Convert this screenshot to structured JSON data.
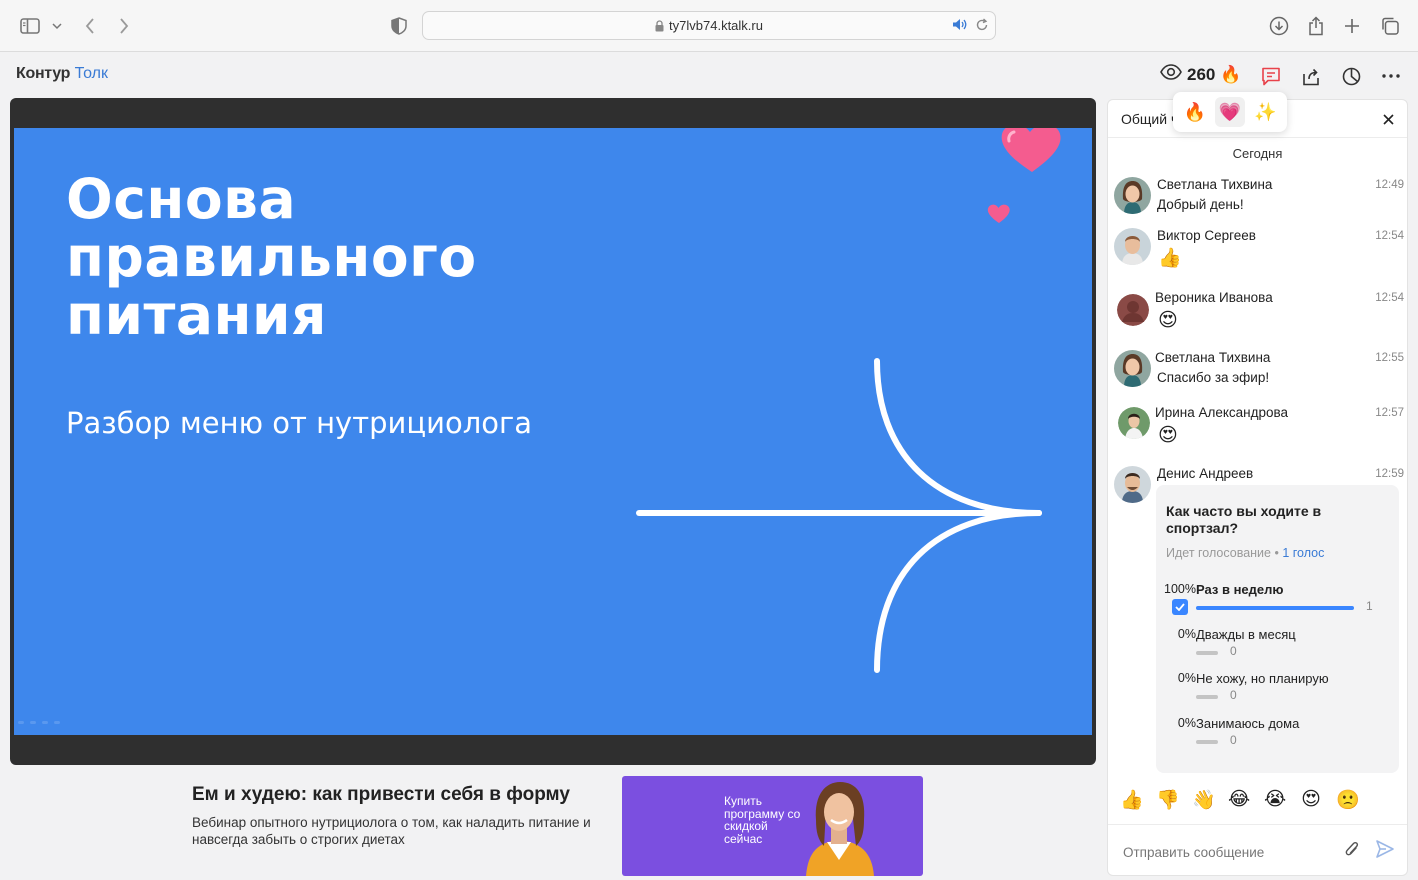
{
  "browser": {
    "url": "ty7lvb74.ktalk.ru"
  },
  "header": {
    "logo_part1": "Контур",
    "logo_part2": "Толк",
    "views": "260",
    "fire_emoji": "🔥"
  },
  "slide": {
    "title": "Основа правильного питания",
    "subtitle": "Разбор меню от нутрициолога"
  },
  "event": {
    "title": "Ем и худею: как привести себя в форму",
    "description": "Вебинар опытного нутрициолога о том, как наладить питание и навсегда забыть о строгих диетах",
    "banner_text": "Купить программу со скидкой сейчас"
  },
  "reaction_popup": [
    "🔥",
    "💗",
    "✨"
  ],
  "chat": {
    "title": "Общий чат",
    "date_divider": "Сегодня",
    "messages": [
      {
        "name": "Светлана Тихвина",
        "time": "12:49",
        "text": "Добрый день!",
        "emoji": ""
      },
      {
        "name": "Виктор Сергеев",
        "time": "12:54",
        "text": "",
        "emoji": "👍"
      },
      {
        "name": "Вероника Иванова",
        "time": "12:54",
        "text": "",
        "emoji": "😍"
      },
      {
        "name": "Светлана Тихвина",
        "time": "12:55",
        "text": "Спасибо за эфир!",
        "emoji": ""
      },
      {
        "name": "Ирина Александрова",
        "time": "12:57",
        "text": "",
        "emoji": "😍"
      },
      {
        "name": "Денис Андреев",
        "time": "12:59",
        "text": "",
        "emoji": ""
      }
    ],
    "poll": {
      "question": "Как часто вы ходите в спортзал?",
      "status": "Идет голосование",
      "votes": "1 голос",
      "options": [
        {
          "label": "Раз в неделю",
          "percent": "100%",
          "count": "1",
          "share": 1.0,
          "checked": true
        },
        {
          "label": "Дважды в месяц",
          "percent": "0%",
          "count": "0",
          "share": 0,
          "checked": false
        },
        {
          "label": "Не хожу, но планирую",
          "percent": "0%",
          "count": "0",
          "share": 0,
          "checked": false
        },
        {
          "label": "Занимаюсь дома",
          "percent": "0%",
          "count": "0",
          "share": 0,
          "checked": false
        }
      ]
    },
    "quick_reactions": [
      "👍",
      "👎",
      "👋",
      "😂",
      "😭",
      "😍",
      "🙁"
    ],
    "composer_placeholder": "Отправить сообщение"
  },
  "colors": {
    "slide": "#3e87ec",
    "accent": "#3a86ff",
    "banner": "#7b4fe0"
  }
}
